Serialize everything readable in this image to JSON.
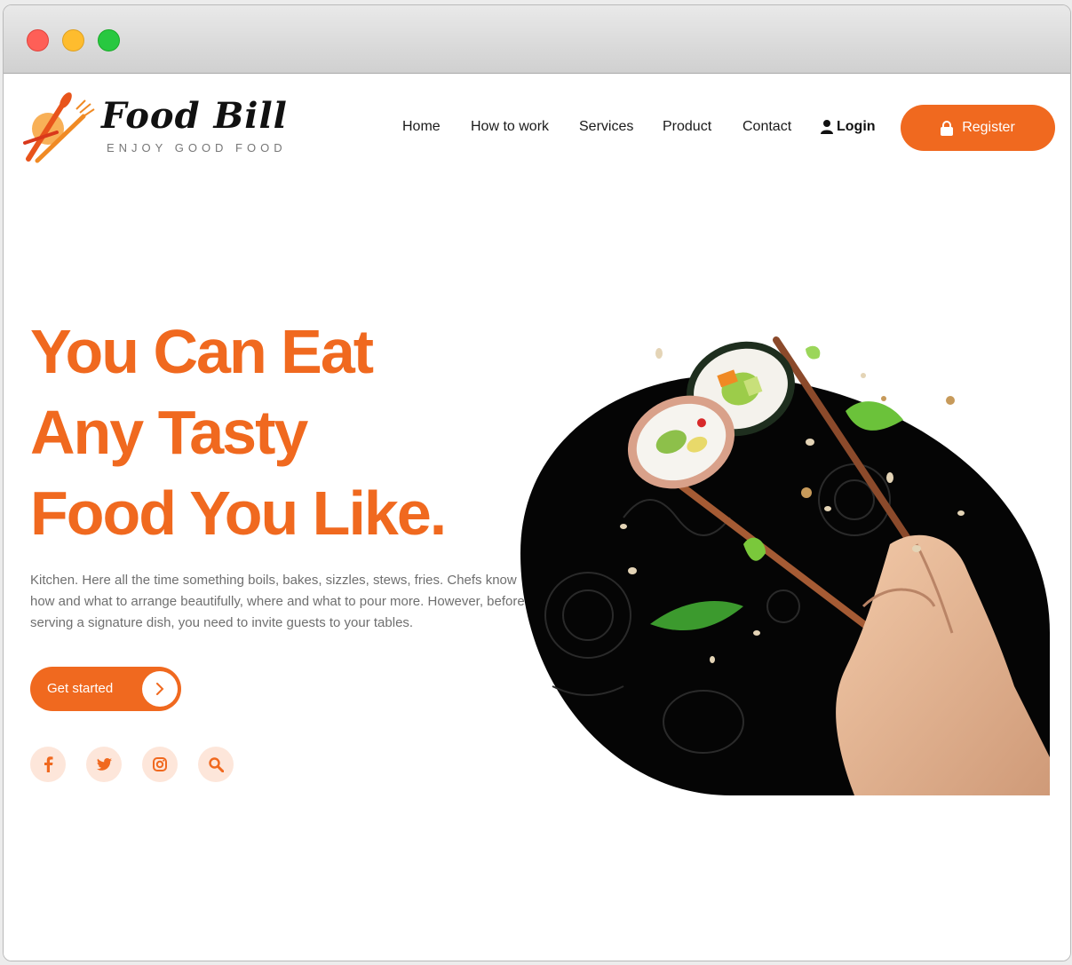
{
  "brand": {
    "name": "Food Bill",
    "tagline": "ENJOY GOOD FOOD",
    "accent": "#f0691f"
  },
  "nav": {
    "items": [
      {
        "label": "Home"
      },
      {
        "label": "How to work"
      },
      {
        "label": "Services"
      },
      {
        "label": "Product"
      },
      {
        "label": "Contact"
      }
    ],
    "login_label": "Login",
    "register_label": "Register"
  },
  "hero": {
    "lines": [
      "You Can Eat",
      "Any Tasty",
      "Food You Like."
    ],
    "description": "Kitchen. Here all the time something boils, bakes, sizzles, stews, fries. Chefs know how and what to arrange beautifully, where and what to pour more. However, before serving a signature dish, you need to invite guests to your tables.",
    "cta_label": "Get started"
  },
  "social": {
    "icons": [
      "facebook-icon",
      "twitter-icon",
      "instagram-icon",
      "search-icon"
    ]
  }
}
